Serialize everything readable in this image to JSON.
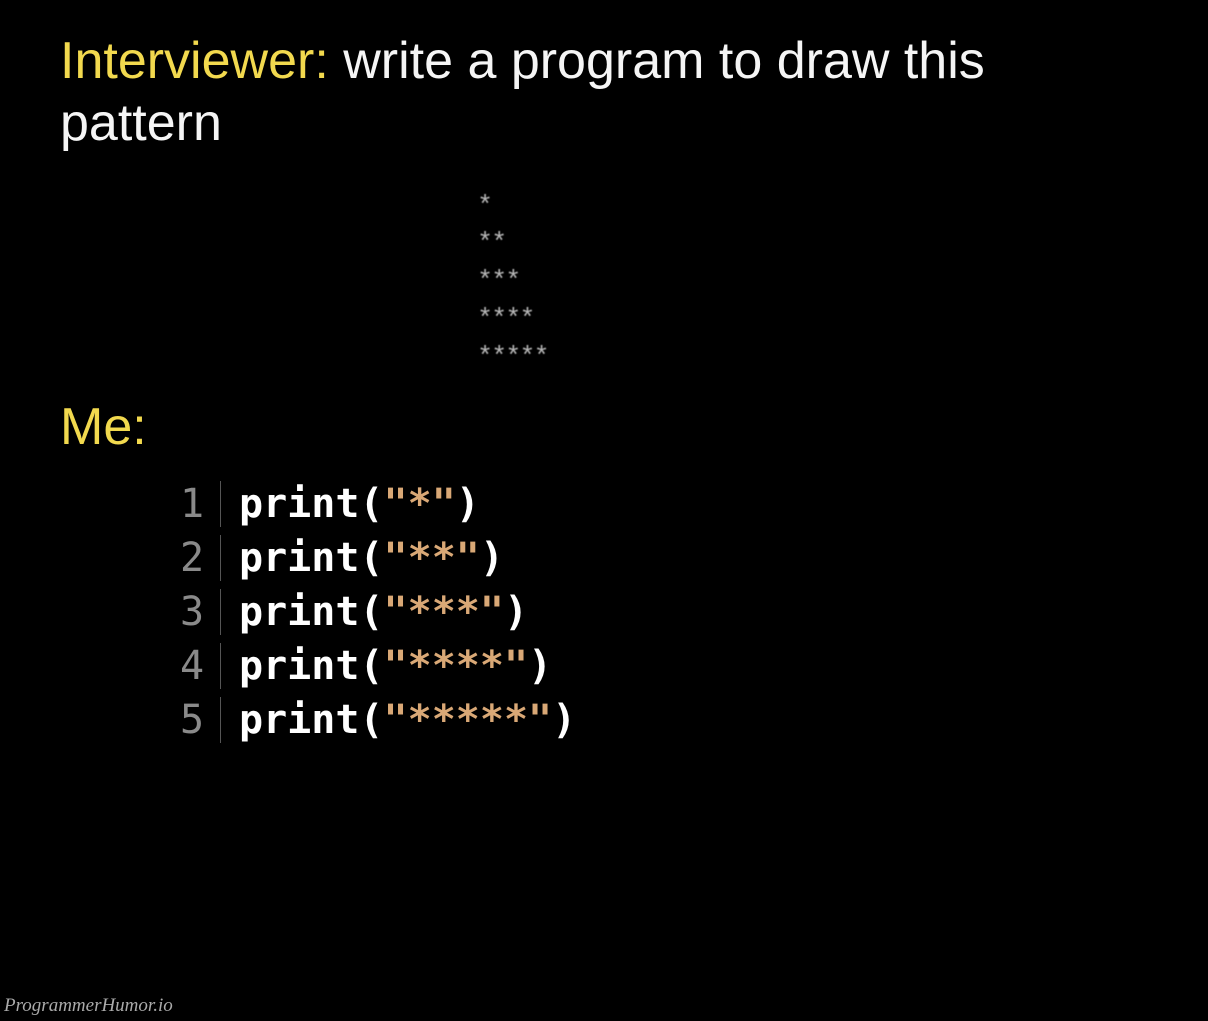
{
  "heading": {
    "interviewer_label": "Interviewer:",
    "prompt": " write a program to draw this pattern"
  },
  "pattern": [
    "*",
    "**",
    "***",
    "****",
    "*****"
  ],
  "me_label": "Me:",
  "code": [
    {
      "n": "1",
      "fn": "print",
      "arg": "*"
    },
    {
      "n": "2",
      "fn": "print",
      "arg": "**"
    },
    {
      "n": "3",
      "fn": "print",
      "arg": "***"
    },
    {
      "n": "4",
      "fn": "print",
      "arg": "****"
    },
    {
      "n": "5",
      "fn": "print",
      "arg": "*****"
    }
  ],
  "watermark": "ProgrammerHumor.io"
}
